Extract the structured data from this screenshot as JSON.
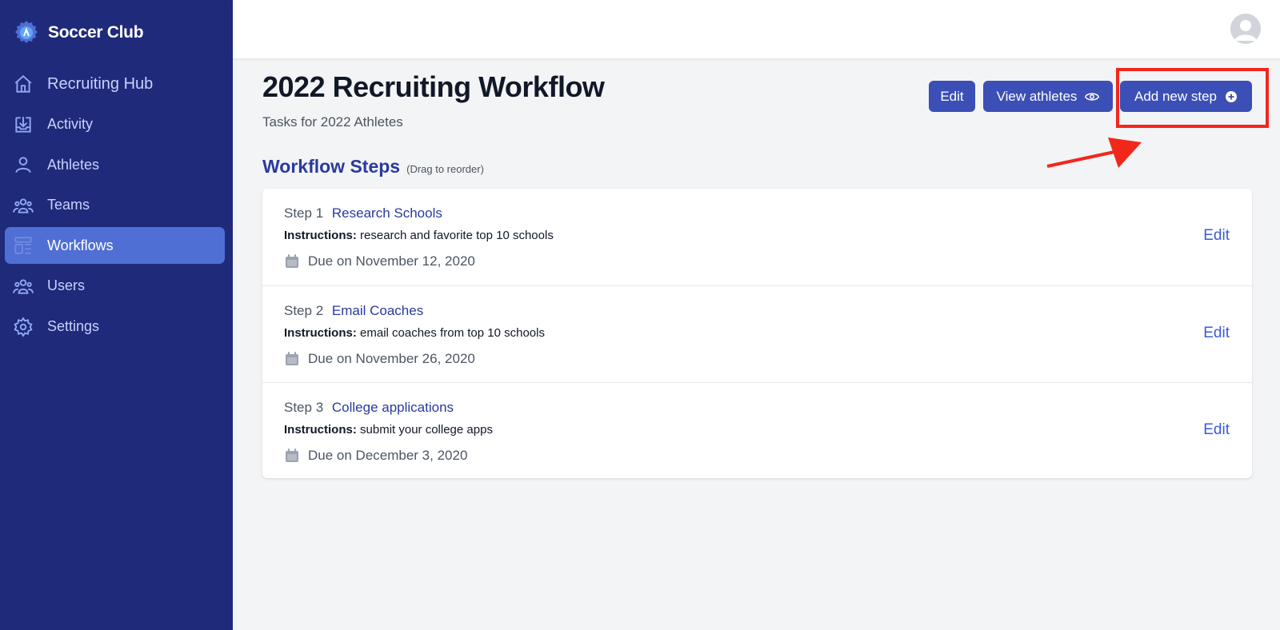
{
  "brand": {
    "name": "Soccer Club",
    "logo_icon": "soccer-gear-logo-icon"
  },
  "sidebar": {
    "items": [
      {
        "label": "Recruiting Hub",
        "icon": "home-icon"
      },
      {
        "label": "Activity",
        "icon": "inbox-download-icon"
      },
      {
        "label": "Athletes",
        "icon": "user-icon"
      },
      {
        "label": "Teams",
        "icon": "user-group-icon"
      },
      {
        "label": "Workflows",
        "icon": "template-icon",
        "active": true
      },
      {
        "label": "Users",
        "icon": "users-icon"
      },
      {
        "label": "Settings",
        "icon": "gear-icon"
      }
    ]
  },
  "header": {
    "avatar_icon": "user-avatar-icon"
  },
  "page": {
    "title": "2022 Recruiting Workflow",
    "subtitle": "Tasks for 2022 Athletes"
  },
  "actions": {
    "edit_label": "Edit",
    "view_label": "View athletes",
    "view_icon": "eye-icon",
    "add_label": "Add new step",
    "add_icon": "plus-circle-icon"
  },
  "section": {
    "title": "Workflow Steps",
    "hint": "(Drag to reorder)"
  },
  "steps": [
    {
      "num": "Step 1",
      "name": "Research Schools",
      "instr_label": "Instructions:",
      "instr": "research and favorite top 10 schools",
      "due": "Due on November 12, 2020",
      "edit": "Edit"
    },
    {
      "num": "Step 2",
      "name": "Email Coaches",
      "instr_label": "Instructions:",
      "instr": "email coaches from top 10 schools",
      "due": "Due on November 26, 2020",
      "edit": "Edit"
    },
    {
      "num": "Step 3",
      "name": "College applications",
      "instr_label": "Instructions:",
      "instr": "submit your college apps",
      "due": "Due on December 3, 2020",
      "edit": "Edit"
    }
  ],
  "annotation": {
    "highlight_color": "#f2271c"
  },
  "colors": {
    "sidebar": "#1f2a7a",
    "active_item": "#4f6fd4",
    "button": "#3b4fb6",
    "link": "#3b5bd6"
  }
}
